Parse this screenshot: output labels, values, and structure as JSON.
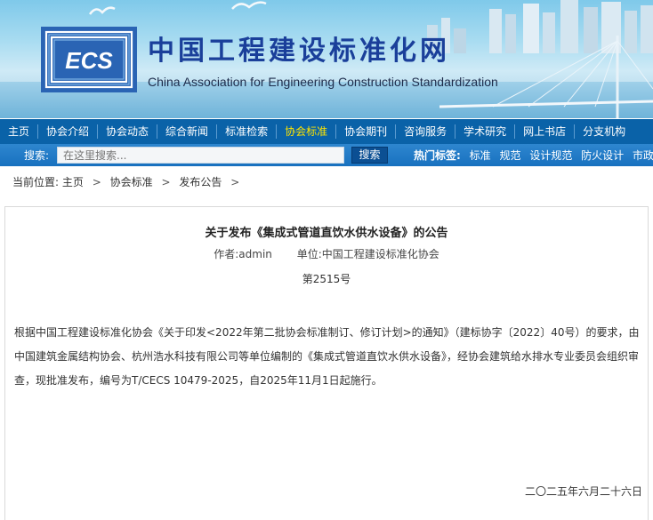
{
  "header": {
    "title_cn": "中国工程建设标准化网",
    "title_en": "China Association for Engineering Construction Standardization",
    "logo_text": "ECS"
  },
  "nav": {
    "items": [
      {
        "label": "主页",
        "active": false
      },
      {
        "label": "协会介绍",
        "active": false
      },
      {
        "label": "协会动态",
        "active": false
      },
      {
        "label": "综合新闻",
        "active": false
      },
      {
        "label": "标准检索",
        "active": false
      },
      {
        "label": "协会标准",
        "active": true
      },
      {
        "label": "协会期刊",
        "active": false
      },
      {
        "label": "咨询服务",
        "active": false
      },
      {
        "label": "学术研究",
        "active": false
      },
      {
        "label": "网上书店",
        "active": false
      },
      {
        "label": "分支机构",
        "active": false
      }
    ]
  },
  "search": {
    "label": "搜索:",
    "placeholder": "在这里搜索...",
    "button": "搜索",
    "hot_label": "热门标签:",
    "hot_tags": [
      "标准",
      "规范",
      "设计规范",
      "防火设计",
      "市政管网"
    ]
  },
  "breadcrumb": {
    "prefix": "当前位置:",
    "items": [
      "主页",
      "协会标准",
      "发布公告"
    ]
  },
  "article": {
    "title": "关于发布《集成式管道直饮水供水设备》的公告",
    "author": "作者:admin",
    "unit": "单位:中国工程建设标准化协会",
    "number": "第2515号",
    "body": "根据中国工程建设标准化协会《关于印发<2022年第二批协会标准制订、修订计划>的通知》（建标协字〔2022〕40号）的要求，由中国建筑金属结构协会、杭州浩水科技有限公司等单位编制的《集成式管道直饮水供水设备》，经协会建筑给水排水专业委员会组织审查，现批准发布，编号为T/CECS 10479-2025，自2025年11月1日起施行。",
    "date": "二〇二五年六月二十六日"
  },
  "colors": {
    "nav_bg": "#0a62a8",
    "nav_active": "#ffe400",
    "search_bg": "#1871bf",
    "title_blue": "#1a3f9a"
  }
}
